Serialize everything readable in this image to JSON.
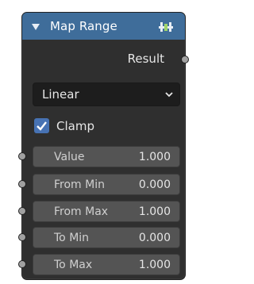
{
  "node": {
    "title": "Map Range",
    "output_label": "Result",
    "interpolation": "Linear",
    "clamp_label": "Clamp",
    "clamp_checked": true,
    "header_color": "#3f6d9a",
    "inputs": [
      {
        "label": "Value",
        "value": "1.000"
      },
      {
        "label": "From Min",
        "value": "0.000"
      },
      {
        "label": "From Max",
        "value": "1.000"
      },
      {
        "label": "To Min",
        "value": "0.000"
      },
      {
        "label": "To Max",
        "value": "1.000"
      }
    ]
  },
  "icons": {
    "collapse": "triangle-down-icon",
    "header": "node-group-icon",
    "dropdown": "chevron-down-icon",
    "check": "checkmark-icon"
  }
}
